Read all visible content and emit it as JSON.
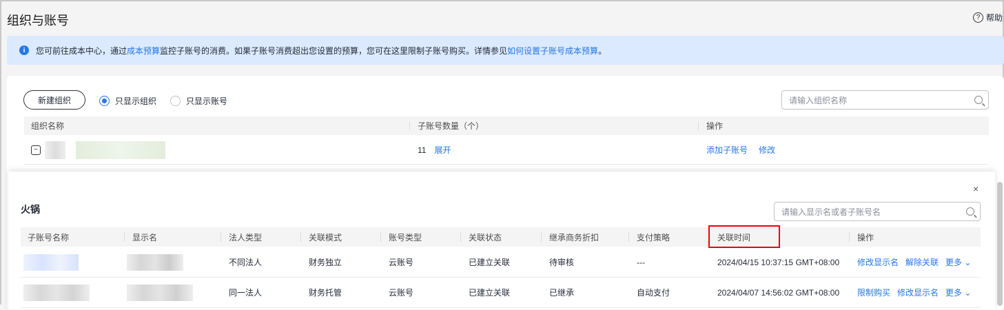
{
  "page": {
    "title": "组织与账号",
    "help": "帮助"
  },
  "notice": {
    "t1": "您可前往成本中心，通过",
    "l1": "成本预算",
    "t2": "监控子账号的消费。如果子账号消费超出您设置的预算，您可在这里限制子账号购买。详情参见",
    "l2": "如何设置子账号成本预算",
    "t3": "。"
  },
  "toolbar": {
    "new_org": "新建组织",
    "radio_org": "只显示组织",
    "radio_acct": "只显示账号",
    "search_placeholder": "请输入组织名称"
  },
  "org_table": {
    "headers": [
      "组织名称",
      "子账号数量（个）",
      "操作"
    ],
    "row": {
      "count": "11",
      "expand": "展开",
      "add": "添加子账号",
      "edit": "修改"
    }
  },
  "sub": {
    "title": "火锅",
    "close": "×",
    "search_placeholder": "请输入显示名或者子账号名",
    "headers": [
      "子账号名称",
      "显示名",
      "法人类型",
      "关联模式",
      "账号类型",
      "关联状态",
      "继承商务折扣",
      "支付策略",
      "关联时间",
      "操作"
    ],
    "rows": [
      {
        "legal": "不同法人",
        "mode": "财务独立",
        "type": "云账号",
        "status": "已建立关联",
        "discount": "待审核",
        "pay": "---",
        "time": "2024/04/15 10:37:15 GMT+08:00",
        "a1": "修改显示名",
        "a2": "解除关联",
        "more": "更多"
      },
      {
        "legal": "同一法人",
        "mode": "财务托管",
        "type": "云账号",
        "status": "已建立关联",
        "discount": "已继承",
        "pay": "自动支付",
        "time": "2024/04/07 14:56:02 GMT+08:00",
        "a1": "限制购买",
        "a2": "修改显示名",
        "more": "更多"
      }
    ]
  },
  "colors": {
    "accent": "#2676e8",
    "highlight": "#e00000"
  }
}
